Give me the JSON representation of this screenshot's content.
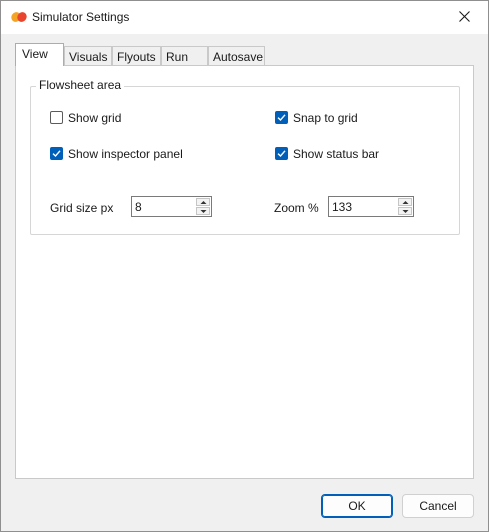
{
  "window": {
    "title": "Simulator Settings"
  },
  "icons": {
    "app": "app-logo-icon",
    "close": "close-icon",
    "check": "checkmark-icon",
    "spin_up": "caret-up-icon",
    "spin_down": "caret-down-icon"
  },
  "colors": {
    "accent": "#005fb8",
    "panel": "#ffffff",
    "window": "#f0f0f0"
  },
  "tabs": [
    {
      "label": "View",
      "selected": true
    },
    {
      "label": "Visuals",
      "selected": false
    },
    {
      "label": "Flyouts",
      "selected": false
    },
    {
      "label": "Run",
      "selected": false
    },
    {
      "label": "Autosave",
      "selected": false
    }
  ],
  "group": {
    "title": "Flowsheet area",
    "checkboxes": [
      {
        "label": "Show grid",
        "checked": false
      },
      {
        "label": "Snap to grid",
        "checked": true
      },
      {
        "label": "Show inspector panel",
        "checked": true
      },
      {
        "label": "Show status bar",
        "checked": true
      }
    ],
    "grid_size": {
      "label": "Grid size px",
      "value": "8"
    },
    "zoom": {
      "label": "Zoom %",
      "value": "133"
    }
  },
  "buttons": {
    "ok": "OK",
    "cancel": "Cancel"
  }
}
